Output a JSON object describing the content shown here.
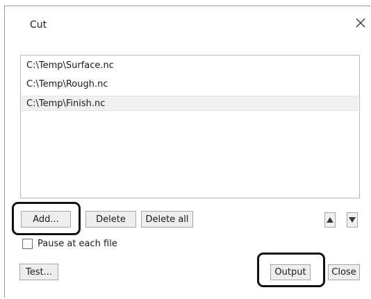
{
  "window": {
    "title": "Cut",
    "close_icon": "close-icon"
  },
  "file_list": {
    "items": [
      {
        "path": "C:\\Temp\\Surface.nc",
        "selected": false
      },
      {
        "path": "C:\\Temp\\Rough.nc",
        "selected": false
      },
      {
        "path": "C:\\Temp\\Finish.nc",
        "selected": true
      }
    ]
  },
  "buttons": {
    "add": "Add...",
    "delete": "Delete",
    "delete_all": "Delete all",
    "move_up_icon": "triangle-up-icon",
    "move_down_icon": "triangle-down-icon",
    "test": "Test...",
    "output": "Output",
    "close": "Close"
  },
  "options": {
    "pause_label": "Pause at each file",
    "pause_checked": false
  },
  "colors": {
    "highlight": "#111111",
    "selected_row": "#f0f0f0",
    "button_face": "#eeeeee"
  }
}
